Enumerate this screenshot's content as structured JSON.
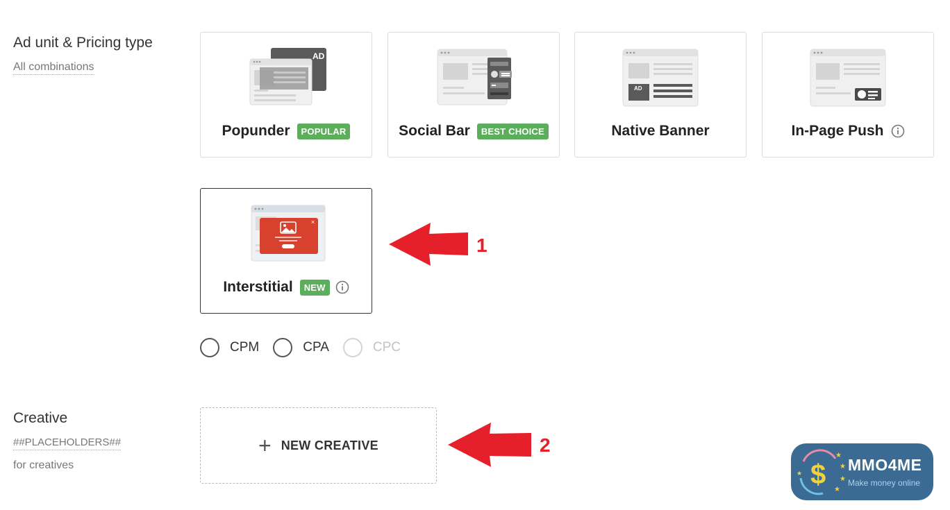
{
  "ad_section": {
    "label": "Ad unit & Pricing type",
    "sub": "All combinations"
  },
  "ad_units": [
    {
      "title": "Popunder",
      "badge": "POPULAR"
    },
    {
      "title": "Social Bar",
      "badge": "BEST CHOICE"
    },
    {
      "title": "Native Banner"
    },
    {
      "title": "In-Page Push"
    },
    {
      "title": "Interstitial",
      "badge": "NEW",
      "selected": true
    }
  ],
  "art_labels": {
    "popunder_ad": "AD",
    "native_ad": "AD"
  },
  "pricing": [
    {
      "label": "CPM",
      "enabled": true
    },
    {
      "label": "CPA",
      "enabled": true
    },
    {
      "label": "CPC",
      "enabled": false
    }
  ],
  "creative_section": {
    "label": "Creative",
    "placeholders": "##PLACEHOLDERS##",
    "sub": "for creatives",
    "new_button": "NEW CREATIVE"
  },
  "annotations": [
    "1",
    "2"
  ],
  "logo": {
    "brand": "MMO4ME",
    "tagline": "Make money online"
  },
  "colors": {
    "badge_green": "#5cae5c",
    "arrow_red": "#e5202a",
    "logo_blue": "#3b6b93",
    "interstitial_red": "#d9412f"
  }
}
